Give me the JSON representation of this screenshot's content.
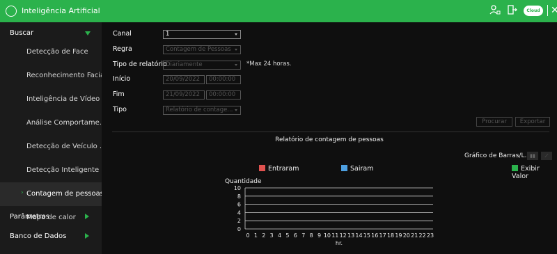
{
  "window": {
    "title": "Inteligência Artificial",
    "cloud_label": "Cloud"
  },
  "sidebar": {
    "buscar": "Buscar",
    "items": [
      {
        "label": "Detecção de Face",
        "active": false
      },
      {
        "label": "Reconhecimento Facial",
        "active": false
      },
      {
        "label": "Inteligência de Vídeo",
        "active": false
      },
      {
        "label": "Análise Comportame...",
        "active": false
      },
      {
        "label": "Detecção de Veículo ...",
        "active": false
      },
      {
        "label": "Detecção Inteligente",
        "active": false
      },
      {
        "label": "Contagem de pessoas",
        "active": true
      },
      {
        "label": "Mapa de calor",
        "active": false
      }
    ],
    "parametros": "Parâmetros",
    "banco": "Banco de Dados"
  },
  "form": {
    "canal_label": "Canal",
    "canal_value": "1",
    "regra_label": "Regra",
    "regra_value": "Contagem de Pessoas",
    "tipo_relatorio_label": "Tipo de relatório",
    "tipo_relatorio_value": "Diariamente",
    "max_note": "*Max 24 horas.",
    "inicio_label": "Início",
    "inicio_date": "20/09/2022",
    "inicio_time": "00:00:00",
    "fim_label": "Fim",
    "fim_date": "21/09/2022",
    "fim_time": "00:00:00",
    "tipo_label": "Tipo",
    "tipo_value": "Relatório de contage..."
  },
  "buttons": {
    "procurar": "Procurar",
    "exportar": "Exportar"
  },
  "report": {
    "title": "Relatório de contagem de pessoas",
    "chart_type_label": "Gráfico de Barras/L...",
    "exibir_valor": "Exibir Valor"
  },
  "colors": {
    "accent": "#2bb24c",
    "entraram": "#e0524f",
    "sairam": "#4d9fe0"
  },
  "chart_data": {
    "type": "bar",
    "ylabel": "Quantidade",
    "xlabel": "hr.",
    "ylim": [
      0,
      10
    ],
    "yticks": [
      "0",
      "2",
      "4",
      "6",
      "8",
      "10"
    ],
    "categories": [
      "0",
      "1",
      "2",
      "3",
      "4",
      "5",
      "6",
      "7",
      "8",
      "9",
      "10",
      "11",
      "12",
      "13",
      "14",
      "15",
      "16",
      "17",
      "18",
      "19",
      "20",
      "21",
      "22",
      "23"
    ],
    "series": [
      {
        "name": "Entraram",
        "values": [
          0,
          0,
          0,
          0,
          0,
          0,
          0,
          0,
          0,
          0,
          0,
          0,
          0,
          0,
          0,
          0,
          0,
          0,
          0,
          0,
          0,
          0,
          0,
          0
        ]
      },
      {
        "name": "Sairam",
        "values": [
          0,
          0,
          0,
          0,
          0,
          0,
          0,
          0,
          0,
          0,
          0,
          0,
          0,
          0,
          0,
          0,
          0,
          0,
          0,
          0,
          0,
          0,
          0,
          0
        ]
      }
    ],
    "legend": "top",
    "grid": true
  }
}
